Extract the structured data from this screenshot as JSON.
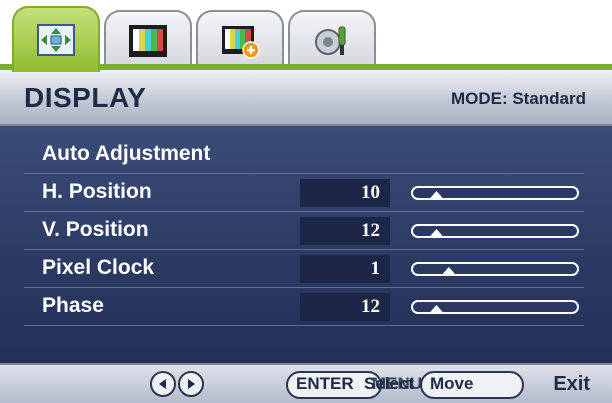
{
  "tabs": [
    {
      "icon": "display-arrows-icon",
      "active": true
    },
    {
      "icon": "picture-icon",
      "active": false
    },
    {
      "icon": "picture-advanced-icon",
      "active": false
    },
    {
      "icon": "system-settings-icon",
      "active": false
    }
  ],
  "header": {
    "title": "DISPLAY",
    "mode_label": "MODE: Standard"
  },
  "menu": {
    "auto_adjustment": "Auto Adjustment",
    "items": [
      {
        "label": "H. Position",
        "value": "10",
        "level": 0.12
      },
      {
        "label": "V. Position",
        "value": "12",
        "level": 0.12
      },
      {
        "label": "Pixel Clock",
        "value": "1",
        "level": 0.2
      },
      {
        "label": "Phase",
        "value": "12",
        "level": 0.12
      }
    ]
  },
  "footer": {
    "enter": "ENTER",
    "menu": "MENU",
    "select": "Select",
    "move": "Move",
    "exit": "Exit"
  },
  "colors": {
    "active_tab": "#8fbc2e",
    "header_text": "#1f2b46",
    "menu_background": "#2b3962",
    "menu_text": "#ffffff"
  }
}
